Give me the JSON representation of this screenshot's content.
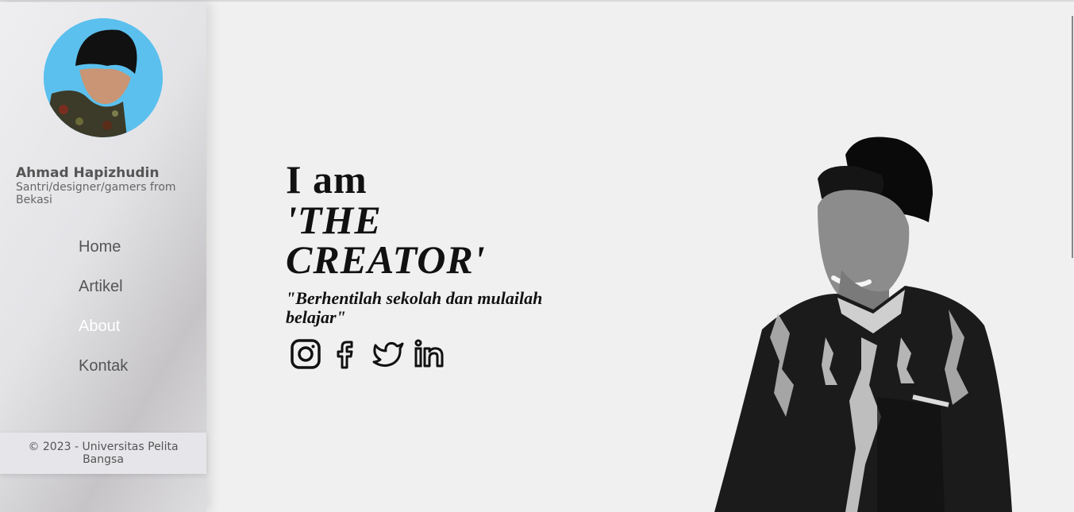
{
  "sidebar": {
    "profile": {
      "name": "Ahmad Hapizhudin",
      "description": "Santri/designer/gamers from Bekasi"
    },
    "nav": [
      {
        "label": "Home",
        "active": false
      },
      {
        "label": "Artikel",
        "active": false
      },
      {
        "label": "About",
        "active": true
      },
      {
        "label": "Kontak",
        "active": false
      }
    ],
    "footer": "© 2023 - Universitas Pelita Bangsa"
  },
  "hero": {
    "intro": "I am",
    "title": "'THE CREATOR'",
    "quote": "\"Berhentilah sekolah dan mulailah belajar\""
  },
  "socials": [
    {
      "icon": "instagram-icon"
    },
    {
      "icon": "facebook-icon"
    },
    {
      "icon": "twitter-icon"
    },
    {
      "icon": "linkedin-icon"
    }
  ],
  "colors": {
    "background": "#f0f0f0",
    "nav_text": "#555555",
    "nav_active": "#ffffff",
    "avatar_bg": "#5bc0ee"
  }
}
